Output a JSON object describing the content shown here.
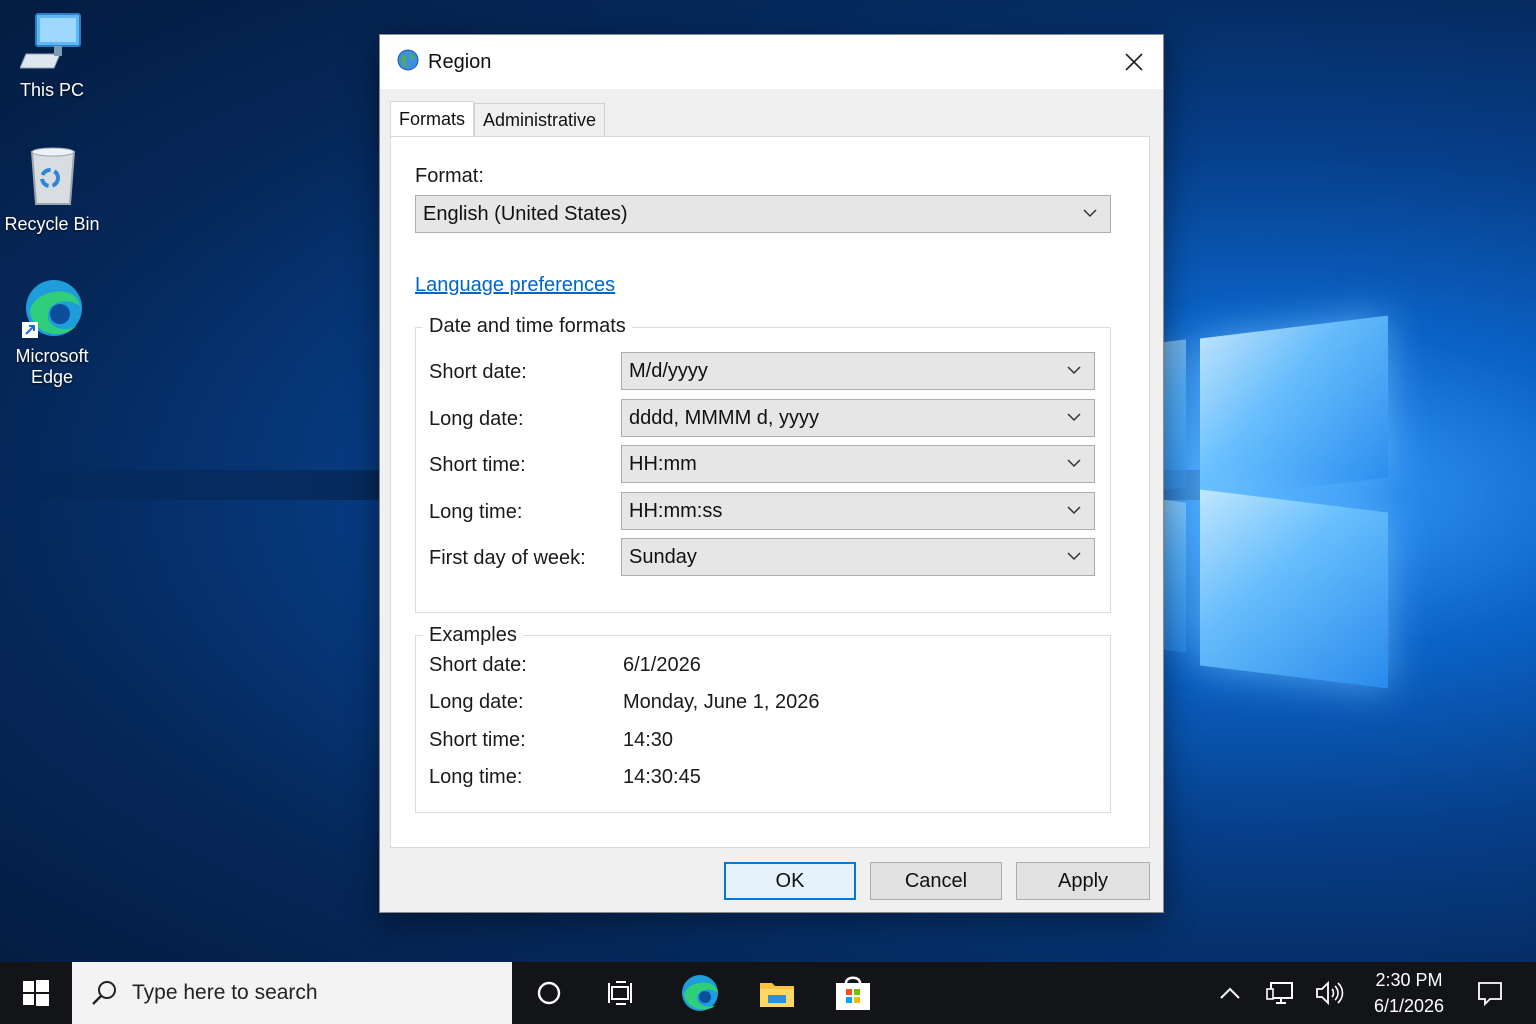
{
  "desktop": {
    "icons": [
      {
        "label": "This PC",
        "icon": "computer-icon"
      },
      {
        "label": "Recycle Bin",
        "icon": "recycle-bin-icon"
      },
      {
        "label": "Microsoft\nEdge",
        "label_line1": "Microsoft",
        "label_line2": "Edge",
        "icon": "edge-icon"
      }
    ]
  },
  "dialog": {
    "title": "Region",
    "tabs": [
      {
        "label": "Formats",
        "active": true
      },
      {
        "label": "Administrative",
        "active": false
      }
    ],
    "format_label": "Format:",
    "format_value": "English (United States)",
    "language_link": "Language preferences",
    "datetime_group": {
      "legend": "Date and time formats",
      "rows": [
        {
          "label": "Short date:",
          "value": "M/d/yyyy"
        },
        {
          "label": "Long date:",
          "value": "dddd, MMMM d, yyyy"
        },
        {
          "label": "Short time:",
          "value": "HH:mm"
        },
        {
          "label": "Long time:",
          "value": "HH:mm:ss"
        },
        {
          "label": "First day of week:",
          "value": "Sunday"
        }
      ]
    },
    "examples_group": {
      "legend": "Examples",
      "rows": [
        {
          "label": "Short date:",
          "value": "6/1/2026"
        },
        {
          "label": "Long date:",
          "value": "Monday, June 1, 2026"
        },
        {
          "label": "Short time:",
          "value": "14:30"
        },
        {
          "label": "Long time:",
          "value": "14:30:45"
        }
      ]
    },
    "buttons": {
      "ok": "OK",
      "cancel": "Cancel",
      "apply": "Apply"
    }
  },
  "taskbar": {
    "search_placeholder": "Type here to search",
    "clock": {
      "time": "2:30 PM",
      "date": "6/1/2026"
    },
    "accent": "#0078d7"
  }
}
